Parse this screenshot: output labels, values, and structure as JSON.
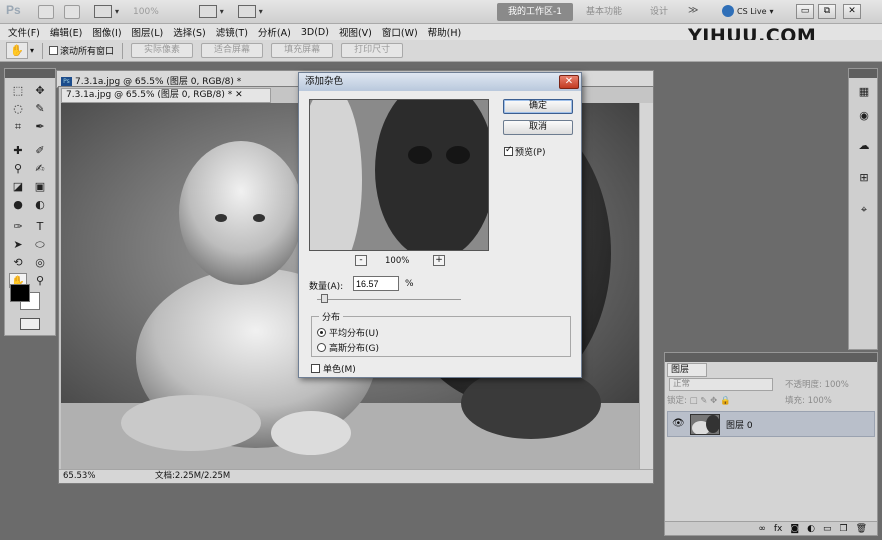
{
  "titlebar": {
    "logo": "Ps",
    "zoom": "100%",
    "workspaces": [
      "我的工作区-1",
      "基本功能",
      "设计"
    ],
    "more": "≫",
    "cslive": "CS Live",
    "win_min": "▭",
    "win_max": "⧉",
    "win_close": "✕"
  },
  "menu": [
    "文件(F)",
    "编辑(E)",
    "图像(I)",
    "图层(L)",
    "选择(S)",
    "滤镜(T)",
    "分析(A)",
    "3D(D)",
    "视图(V)",
    "窗口(W)",
    "帮助(H)"
  ],
  "brand": "YIHUU.COM",
  "options": {
    "scroll_all": "滚动所有窗口",
    "buttons": [
      "实际像素",
      "适合屏幕",
      "填充屏幕",
      "打印尺寸"
    ]
  },
  "documents": {
    "back_title": "7.3.1a.jpg @ 65.5% (图层 0, RGB/8) *",
    "front_title": "7.3.1a.jpg @ 65.5% (图层 0, RGB/8) *",
    "zoom": "65.53%",
    "doc_info": "文档:2.25M/2.25M"
  },
  "dialog": {
    "title": "添加杂色",
    "ok": "确定",
    "cancel": "取消",
    "preview": "预览(P)",
    "preview_zoom": "100%",
    "zoom_out": "-",
    "zoom_in": "+",
    "amount_label": "数量(A):",
    "amount_value": "16.57",
    "amount_unit": "%",
    "amount_fraction": 0.042,
    "distribution_label": "分布",
    "uniform": "平均分布(U)",
    "gaussian": "高斯分布(G)",
    "monochrome": "单色(M)"
  },
  "layers": {
    "tab": "图层",
    "blend_mode": "正常",
    "opacity_label": "不透明度:",
    "opacity": "100%",
    "lock_label": "锁定:",
    "fill_label": "填充:",
    "fill": "100%",
    "layer_name": "图层 0"
  }
}
